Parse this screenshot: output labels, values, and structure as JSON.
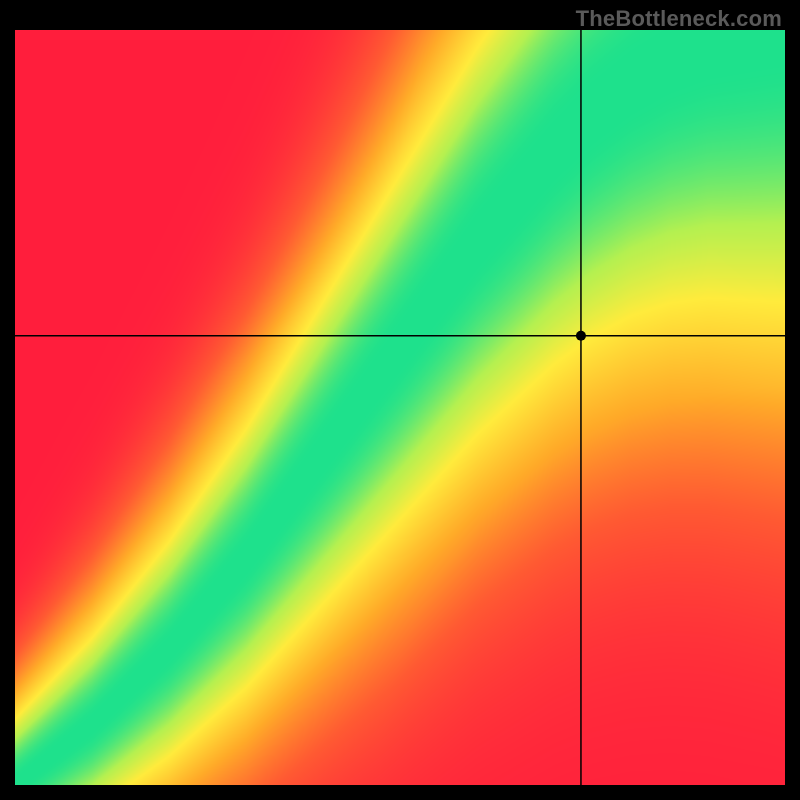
{
  "watermark": "TheBottleneck.com",
  "chart_data": {
    "type": "heatmap",
    "title": "",
    "xlabel": "",
    "ylabel": "",
    "xlim": [
      0,
      1
    ],
    "ylim": [
      0,
      1
    ],
    "colorscale": "red-orange-yellow-green",
    "crosshair": {
      "x": 0.735,
      "y": 0.595
    },
    "marker": {
      "x": 0.735,
      "y": 0.595
    },
    "ridge_peak": {
      "description": "Approximate y-position of the green optimal band as a function of x (normalized 0..1). Heatmap value = 1 on this curve, falling off with distance.",
      "x": [
        0.0,
        0.05,
        0.1,
        0.15,
        0.2,
        0.25,
        0.3,
        0.35,
        0.4,
        0.45,
        0.5,
        0.55,
        0.6,
        0.65,
        0.7,
        0.75,
        0.8,
        0.85,
        0.9,
        0.95,
        1.0
      ],
      "y": [
        0.0,
        0.04,
        0.08,
        0.13,
        0.18,
        0.24,
        0.3,
        0.37,
        0.44,
        0.51,
        0.58,
        0.65,
        0.72,
        0.78,
        0.84,
        0.89,
        0.93,
        0.96,
        0.98,
        0.99,
        1.0
      ]
    },
    "band_halfwidth": {
      "description": "Approximate half-width of the green band (normalized y) around the ridge peak.",
      "x": [
        0.0,
        0.1,
        0.2,
        0.3,
        0.4,
        0.5,
        0.6,
        0.7,
        0.8,
        0.9,
        1.0
      ],
      "hw": [
        0.01,
        0.015,
        0.02,
        0.028,
        0.035,
        0.042,
        0.048,
        0.052,
        0.055,
        0.058,
        0.06
      ]
    }
  }
}
